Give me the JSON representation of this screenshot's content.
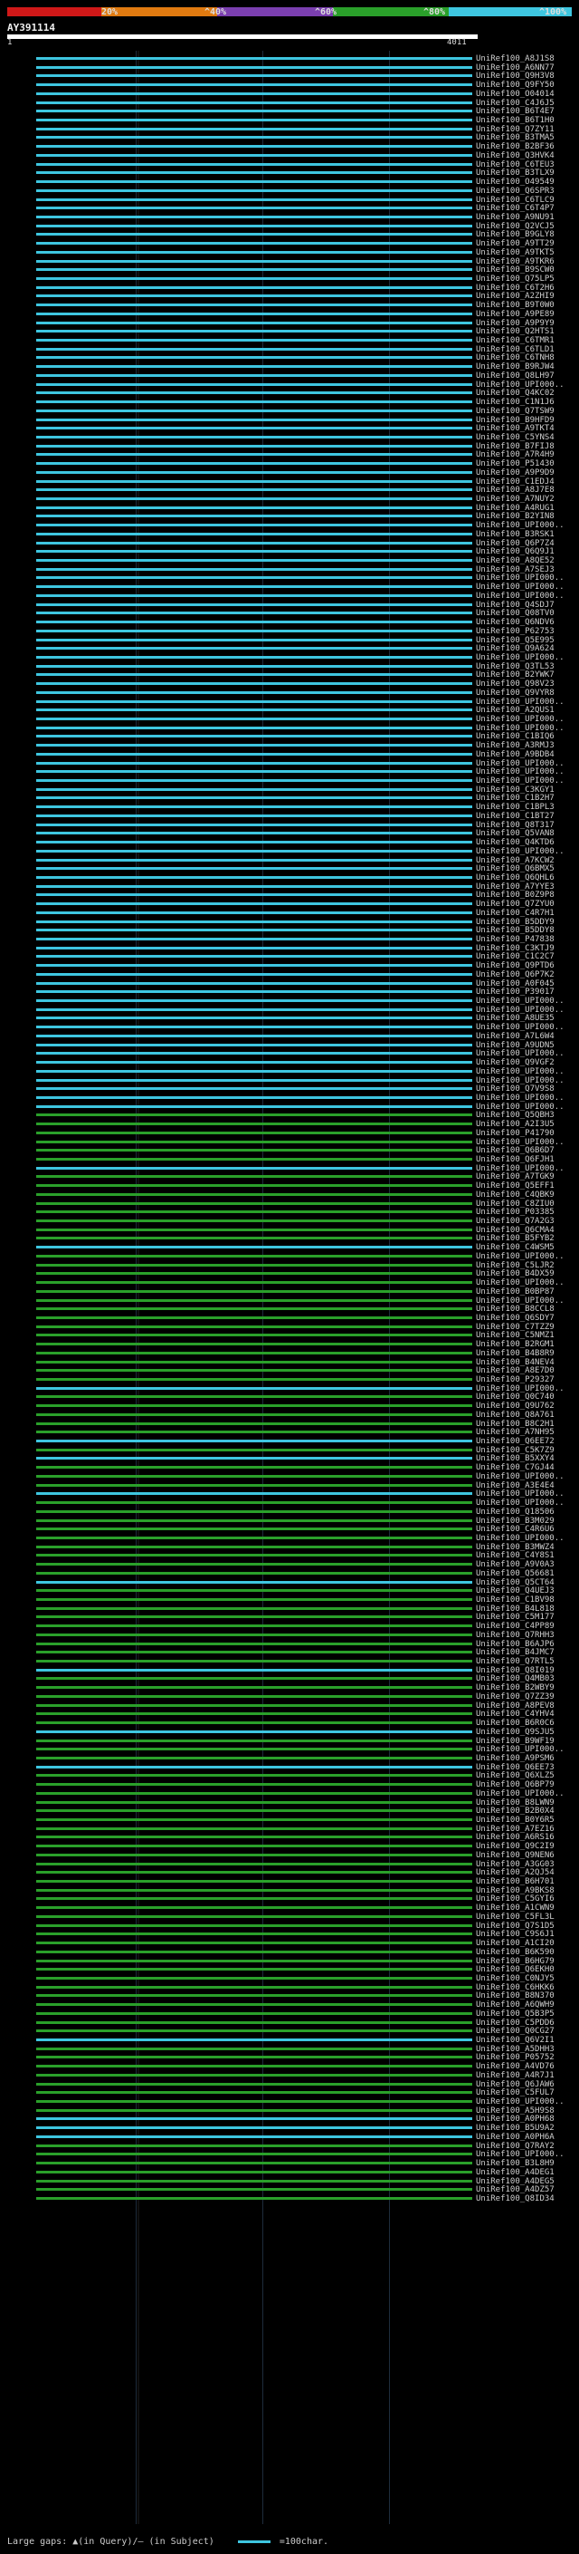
{
  "legend": {
    "ticks": [
      "20%",
      "^40%",
      "^60%",
      "^80%",
      "^100%"
    ],
    "colors": [
      "#d01818",
      "#e07a10",
      "#7b3fb0",
      "#2aa02a",
      "#3ec6e0"
    ]
  },
  "query": {
    "title": "AY391114",
    "start": "1",
    "end": "4011"
  },
  "footer": {
    "gaps_text": "Large gaps: ▲(in Query)/— (in Subject)",
    "scale_text": "=100char."
  },
  "hits": [
    {
      "label": "UniRef100_A8J1S8",
      "color": "#3ec6e0"
    },
    {
      "label": "UniRef100_A6NN77",
      "color": "#3ec6e0"
    },
    {
      "label": "UniRef100_Q9H3V8",
      "color": "#3ec6e0"
    },
    {
      "label": "UniRef100_Q9FY50",
      "color": "#3ec6e0"
    },
    {
      "label": "UniRef100_O04014",
      "color": "#3ec6e0"
    },
    {
      "label": "UniRef100_C4J6J5",
      "color": "#3ec6e0"
    },
    {
      "label": "UniRef100_B6T4E7",
      "color": "#3ec6e0"
    },
    {
      "label": "UniRef100_B6T1H0",
      "color": "#3ec6e0"
    },
    {
      "label": "UniRef100_Q7ZY11",
      "color": "#3ec6e0"
    },
    {
      "label": "UniRef100_B3TMA5",
      "color": "#3ec6e0"
    },
    {
      "label": "UniRef100_B2BF36",
      "color": "#3ec6e0"
    },
    {
      "label": "UniRef100_Q3HVK4",
      "color": "#3ec6e0"
    },
    {
      "label": "UniRef100_C6TEU3",
      "color": "#3ec6e0"
    },
    {
      "label": "UniRef100_B3TLX9",
      "color": "#3ec6e0"
    },
    {
      "label": "UniRef100_O49549",
      "color": "#3ec6e0"
    },
    {
      "label": "UniRef100_Q6SPR3",
      "color": "#3ec6e0"
    },
    {
      "label": "UniRef100_C6TLC9",
      "color": "#3ec6e0"
    },
    {
      "label": "UniRef100_C6T4P7",
      "color": "#3ec6e0"
    },
    {
      "label": "UniRef100_A9NU91",
      "color": "#3ec6e0"
    },
    {
      "label": "UniRef100_Q2VCJ5",
      "color": "#3ec6e0"
    },
    {
      "label": "UniRef100_B9GLY8",
      "color": "#3ec6e0"
    },
    {
      "label": "UniRef100_A9TT29",
      "color": "#3ec6e0"
    },
    {
      "label": "UniRef100_A9TKT5",
      "color": "#3ec6e0"
    },
    {
      "label": "UniRef100_A9TKR6",
      "color": "#3ec6e0"
    },
    {
      "label": "UniRef100_B9SCW0",
      "color": "#3ec6e0"
    },
    {
      "label": "UniRef100_Q75LP5",
      "color": "#3ec6e0"
    },
    {
      "label": "UniRef100_C6T2H6",
      "color": "#3ec6e0"
    },
    {
      "label": "UniRef100_A2ZHI9",
      "color": "#3ec6e0"
    },
    {
      "label": "UniRef100_B9T0W0",
      "color": "#3ec6e0"
    },
    {
      "label": "UniRef100_A9PE89",
      "color": "#3ec6e0"
    },
    {
      "label": "UniRef100_A9P9Y9",
      "color": "#3ec6e0"
    },
    {
      "label": "UniRef100_Q2HTS1",
      "color": "#3ec6e0"
    },
    {
      "label": "UniRef100_C6TMR1",
      "color": "#3ec6e0"
    },
    {
      "label": "UniRef100_C6TLD1",
      "color": "#3ec6e0"
    },
    {
      "label": "UniRef100_C6TNH8",
      "color": "#3ec6e0"
    },
    {
      "label": "UniRef100_B9RJW4",
      "color": "#3ec6e0"
    },
    {
      "label": "UniRef100_Q8LH97",
      "color": "#3ec6e0"
    },
    {
      "label": "UniRef100_UPI000..",
      "color": "#3ec6e0"
    },
    {
      "label": "UniRef100_Q4KC02",
      "color": "#3ec6e0"
    },
    {
      "label": "UniRef100_C1N1J6",
      "color": "#3ec6e0"
    },
    {
      "label": "UniRef100_Q7TSW9",
      "color": "#3ec6e0"
    },
    {
      "label": "UniRef100_B9HFD9",
      "color": "#3ec6e0"
    },
    {
      "label": "UniRef100_A9TKT4",
      "color": "#3ec6e0"
    },
    {
      "label": "UniRef100_C5YNS4",
      "color": "#3ec6e0"
    },
    {
      "label": "UniRef100_B7FIJ8",
      "color": "#3ec6e0"
    },
    {
      "label": "UniRef100_A7R4H9",
      "color": "#3ec6e0"
    },
    {
      "label": "UniRef100_P51430",
      "color": "#3ec6e0"
    },
    {
      "label": "UniRef100_A9P9D9",
      "color": "#3ec6e0"
    },
    {
      "label": "UniRef100_C1EDJ4",
      "color": "#3ec6e0"
    },
    {
      "label": "UniRef100_A8J7E8",
      "color": "#3ec6e0"
    },
    {
      "label": "UniRef100_A7NUY2",
      "color": "#3ec6e0"
    },
    {
      "label": "UniRef100_A4RUG1",
      "color": "#3ec6e0"
    },
    {
      "label": "UniRef100_B2YIN8",
      "color": "#3ec6e0"
    },
    {
      "label": "UniRef100_UPI000..",
      "color": "#3ec6e0"
    },
    {
      "label": "UniRef100_B3RSK1",
      "color": "#3ec6e0"
    },
    {
      "label": "UniRef100_Q6P7Z4",
      "color": "#3ec6e0"
    },
    {
      "label": "UniRef100_Q6Q9J1",
      "color": "#3ec6e0"
    },
    {
      "label": "UniRef100_A8QE52",
      "color": "#3ec6e0"
    },
    {
      "label": "UniRef100_A7SEJ3",
      "color": "#3ec6e0"
    },
    {
      "label": "UniRef100_UPI000..",
      "color": "#3ec6e0"
    },
    {
      "label": "UniRef100_UPI000..",
      "color": "#3ec6e0"
    },
    {
      "label": "UniRef100_UPI000..",
      "color": "#3ec6e0"
    },
    {
      "label": "UniRef100_Q4SDJ7",
      "color": "#3ec6e0"
    },
    {
      "label": "UniRef100_Q08TV0",
      "color": "#3ec6e0"
    },
    {
      "label": "UniRef100_Q6NDV6",
      "color": "#3ec6e0"
    },
    {
      "label": "UniRef100_P62753",
      "color": "#3ec6e0"
    },
    {
      "label": "UniRef100_Q5E995",
      "color": "#3ec6e0"
    },
    {
      "label": "UniRef100_Q9A624",
      "color": "#3ec6e0"
    },
    {
      "label": "UniRef100_UPI000..",
      "color": "#3ec6e0"
    },
    {
      "label": "UniRef100_Q3TL53",
      "color": "#3ec6e0"
    },
    {
      "label": "UniRef100_B2YWK7",
      "color": "#3ec6e0"
    },
    {
      "label": "UniRef100_Q98V23",
      "color": "#3ec6e0"
    },
    {
      "label": "UniRef100_Q9VYR8",
      "color": "#3ec6e0"
    },
    {
      "label": "UniRef100_UPI000..",
      "color": "#3ec6e0"
    },
    {
      "label": "UniRef100_A2QUS1",
      "color": "#3ec6e0"
    },
    {
      "label": "UniRef100_UPI000..",
      "color": "#3ec6e0"
    },
    {
      "label": "UniRef100_UPI000..",
      "color": "#3ec6e0"
    },
    {
      "label": "UniRef100_C1BIQ6",
      "color": "#3ec6e0"
    },
    {
      "label": "UniRef100_A3RMJ3",
      "color": "#3ec6e0"
    },
    {
      "label": "UniRef100_A9BDB4",
      "color": "#3ec6e0"
    },
    {
      "label": "UniRef100_UPI000..",
      "color": "#3ec6e0"
    },
    {
      "label": "UniRef100_UPI000..",
      "color": "#3ec6e0"
    },
    {
      "label": "UniRef100_UPI000..",
      "color": "#3ec6e0"
    },
    {
      "label": "UniRef100_C3KGY1",
      "color": "#3ec6e0"
    },
    {
      "label": "UniRef100_C1B2H7",
      "color": "#3ec6e0"
    },
    {
      "label": "UniRef100_C1BPL3",
      "color": "#3ec6e0"
    },
    {
      "label": "UniRef100_C1BT27",
      "color": "#3ec6e0"
    },
    {
      "label": "UniRef100_Q8T317",
      "color": "#3ec6e0"
    },
    {
      "label": "UniRef100_Q5VAN8",
      "color": "#3ec6e0"
    },
    {
      "label": "UniRef100_Q4KTD6",
      "color": "#3ec6e0"
    },
    {
      "label": "UniRef100_UPI000..",
      "color": "#3ec6e0"
    },
    {
      "label": "UniRef100_A7KCW2",
      "color": "#3ec6e0"
    },
    {
      "label": "UniRef100_Q6BMX5",
      "color": "#3ec6e0"
    },
    {
      "label": "UniRef100_Q6QHL6",
      "color": "#3ec6e0"
    },
    {
      "label": "UniRef100_A7YYE3",
      "color": "#3ec6e0"
    },
    {
      "label": "UniRef100_B0Z9P8",
      "color": "#3ec6e0"
    },
    {
      "label": "UniRef100_Q7ZYU0",
      "color": "#3ec6e0"
    },
    {
      "label": "UniRef100_C4R7H1",
      "color": "#3ec6e0"
    },
    {
      "label": "UniRef100_B5DDY9",
      "color": "#3ec6e0"
    },
    {
      "label": "UniRef100_B5DDY8",
      "color": "#3ec6e0"
    },
    {
      "label": "UniRef100_P47838",
      "color": "#3ec6e0"
    },
    {
      "label": "UniRef100_C3KTJ9",
      "color": "#3ec6e0"
    },
    {
      "label": "UniRef100_C1C2C7",
      "color": "#3ec6e0"
    },
    {
      "label": "UniRef100_Q9PTD6",
      "color": "#3ec6e0"
    },
    {
      "label": "UniRef100_Q6P7K2",
      "color": "#3ec6e0"
    },
    {
      "label": "UniRef100_A0F045",
      "color": "#3ec6e0"
    },
    {
      "label": "UniRef100_P39017",
      "color": "#3ec6e0"
    },
    {
      "label": "UniRef100_UPI000..",
      "color": "#3ec6e0"
    },
    {
      "label": "UniRef100_UPI000..",
      "color": "#3ec6e0"
    },
    {
      "label": "UniRef100_A8UE35",
      "color": "#3ec6e0"
    },
    {
      "label": "UniRef100_UPI000..",
      "color": "#3ec6e0"
    },
    {
      "label": "UniRef100_A7L6W4",
      "color": "#3ec6e0"
    },
    {
      "label": "UniRef100_A9UDN5",
      "color": "#3ec6e0"
    },
    {
      "label": "UniRef100_UPI000..",
      "color": "#3ec6e0"
    },
    {
      "label": "UniRef100_Q9VGF2",
      "color": "#3ec6e0"
    },
    {
      "label": "UniRef100_UPI000..",
      "color": "#3ec6e0"
    },
    {
      "label": "UniRef100_UPI000..",
      "color": "#3ec6e0"
    },
    {
      "label": "UniRef100_Q7V9S8",
      "color": "#3ec6e0"
    },
    {
      "label": "UniRef100_UPI000..",
      "color": "#3ec6e0"
    },
    {
      "label": "UniRef100_UPI000..",
      "color": "#3ec6e0"
    },
    {
      "label": "UniRef100_Q5QBH3",
      "color": "#2aa02a"
    },
    {
      "label": "UniRef100_A2I3U5",
      "color": "#2aa02a"
    },
    {
      "label": "UniRef100_P41790",
      "color": "#2aa02a"
    },
    {
      "label": "UniRef100_UPI000..",
      "color": "#2aa02a"
    },
    {
      "label": "UniRef100_Q6B6D7",
      "color": "#2aa02a"
    },
    {
      "label": "UniRef100_Q6FJH1",
      "color": "#2aa02a"
    },
    {
      "label": "UniRef100_UPI000..",
      "color": "#3ec6e0"
    },
    {
      "label": "UniRef100_A7TGK9",
      "color": "#2aa02a"
    },
    {
      "label": "UniRef100_Q5EFF1",
      "color": "#2aa02a"
    },
    {
      "label": "UniRef100_C4QBK9",
      "color": "#2aa02a"
    },
    {
      "label": "UniRef100_C8ZIU0",
      "color": "#2aa02a"
    },
    {
      "label": "UniRef100_P03385",
      "color": "#2aa02a"
    },
    {
      "label": "UniRef100_Q7A2G3",
      "color": "#2aa02a"
    },
    {
      "label": "UniRef100_Q6CMA4",
      "color": "#2aa02a"
    },
    {
      "label": "UniRef100_B5FYB2",
      "color": "#2aa02a"
    },
    {
      "label": "UniRef100_C4WSM5",
      "color": "#3ec6e0"
    },
    {
      "label": "UniRef100_UPI000..",
      "color": "#2aa02a"
    },
    {
      "label": "UniRef100_C5LJR2",
      "color": "#2aa02a"
    },
    {
      "label": "UniRef100_B4DX59",
      "color": "#2aa02a"
    },
    {
      "label": "UniRef100_UPI000..",
      "color": "#2aa02a"
    },
    {
      "label": "UniRef100_B0BP87",
      "color": "#2aa02a"
    },
    {
      "label": "UniRef100_UPI000..",
      "color": "#2aa02a"
    },
    {
      "label": "UniRef100_B8CCL8",
      "color": "#2aa02a"
    },
    {
      "label": "UniRef100_Q6SDY7",
      "color": "#2aa02a"
    },
    {
      "label": "UniRef100_C7TZZ9",
      "color": "#2aa02a"
    },
    {
      "label": "UniRef100_C5NMZ1",
      "color": "#2aa02a"
    },
    {
      "label": "UniRef100_B2RGM1",
      "color": "#2aa02a"
    },
    {
      "label": "UniRef100_B4B8R9",
      "color": "#2aa02a"
    },
    {
      "label": "UniRef100_B4NEV4",
      "color": "#2aa02a"
    },
    {
      "label": "UniRef100_A8E7D0",
      "color": "#2aa02a"
    },
    {
      "label": "UniRef100_P29327",
      "color": "#2aa02a"
    },
    {
      "label": "UniRef100_UPI000..",
      "color": "#3ec6e0"
    },
    {
      "label": "UniRef100_Q0C740",
      "color": "#2aa02a"
    },
    {
      "label": "UniRef100_Q9U762",
      "color": "#2aa02a"
    },
    {
      "label": "UniRef100_Q8A761",
      "color": "#2aa02a"
    },
    {
      "label": "UniRef100_B8C2H1",
      "color": "#2aa02a"
    },
    {
      "label": "UniRef100_A7NH95",
      "color": "#2aa02a"
    },
    {
      "label": "UniRef100_Q6EE72",
      "color": "#3ec6e0"
    },
    {
      "label": "UniRef100_C5K7Z9",
      "color": "#2aa02a"
    },
    {
      "label": "UniRef100_B5XXY4",
      "color": "#3ec6e0"
    },
    {
      "label": "UniRef100_C7GJ44",
      "color": "#2aa02a"
    },
    {
      "label": "UniRef100_UPI000..",
      "color": "#2aa02a"
    },
    {
      "label": "UniRef100_A3E4E4",
      "color": "#2aa02a"
    },
    {
      "label": "UniRef100_UPI000..",
      "color": "#3ec6e0"
    },
    {
      "label": "UniRef100_UPI000..",
      "color": "#2aa02a"
    },
    {
      "label": "UniRef100_Q18506",
      "color": "#2aa02a"
    },
    {
      "label": "UniRef100_B3M029",
      "color": "#2aa02a"
    },
    {
      "label": "UniRef100_C4R6U6",
      "color": "#2aa02a"
    },
    {
      "label": "UniRef100_UPI000..",
      "color": "#2aa02a"
    },
    {
      "label": "UniRef100_B3MWZ4",
      "color": "#2aa02a"
    },
    {
      "label": "UniRef100_C4Y8S1",
      "color": "#2aa02a"
    },
    {
      "label": "UniRef100_A9V0A3",
      "color": "#2aa02a"
    },
    {
      "label": "UniRef100_Q56681",
      "color": "#2aa02a"
    },
    {
      "label": "UniRef100_Q5CT64",
      "color": "#3ec6e0"
    },
    {
      "label": "UniRef100_Q4UEJ3",
      "color": "#2aa02a"
    },
    {
      "label": "UniRef100_C1BV98",
      "color": "#2aa02a"
    },
    {
      "label": "UniRef100_B4L818",
      "color": "#2aa02a"
    },
    {
      "label": "UniRef100_C5M177",
      "color": "#2aa02a"
    },
    {
      "label": "UniRef100_C4PP89",
      "color": "#2aa02a"
    },
    {
      "label": "UniRef100_Q7RHH3",
      "color": "#2aa02a"
    },
    {
      "label": "UniRef100_B6AJP6",
      "color": "#2aa02a"
    },
    {
      "label": "UniRef100_B4JMC7",
      "color": "#2aa02a"
    },
    {
      "label": "UniRef100_Q7RTL5",
      "color": "#2aa02a"
    },
    {
      "label": "UniRef100_Q8I019",
      "color": "#3ec6e0"
    },
    {
      "label": "UniRef100_Q4MB03",
      "color": "#2aa02a"
    },
    {
      "label": "UniRef100_B2WBY9",
      "color": "#2aa02a"
    },
    {
      "label": "UniRef100_Q7ZZ39",
      "color": "#2aa02a"
    },
    {
      "label": "UniRef100_A8PEV8",
      "color": "#2aa02a"
    },
    {
      "label": "UniRef100_C4YHV4",
      "color": "#2aa02a"
    },
    {
      "label": "UniRef100_B6R0C6",
      "color": "#2aa02a"
    },
    {
      "label": "UniRef100_Q9SJU5",
      "color": "#3ec6e0"
    },
    {
      "label": "UniRef100_B9WF19",
      "color": "#2aa02a"
    },
    {
      "label": "UniRef100_UPI000..",
      "color": "#2aa02a"
    },
    {
      "label": "UniRef100_A9PSM6",
      "color": "#2aa02a"
    },
    {
      "label": "UniRef100_Q6EE73",
      "color": "#3ec6e0"
    },
    {
      "label": "UniRef100_Q6XLZ5",
      "color": "#2aa02a"
    },
    {
      "label": "UniRef100_Q6BP79",
      "color": "#2aa02a"
    },
    {
      "label": "UniRef100_UPI000..",
      "color": "#2aa02a"
    },
    {
      "label": "UniRef100_B8LWN9",
      "color": "#2aa02a"
    },
    {
      "label": "UniRef100_B2B0X4",
      "color": "#2aa02a"
    },
    {
      "label": "UniRef100_B0Y6R5",
      "color": "#2aa02a"
    },
    {
      "label": "UniRef100_A7EZ16",
      "color": "#2aa02a"
    },
    {
      "label": "UniRef100_A6RS16",
      "color": "#2aa02a"
    },
    {
      "label": "UniRef100_Q9C2I9",
      "color": "#2aa02a"
    },
    {
      "label": "UniRef100_Q9NEN6",
      "color": "#2aa02a"
    },
    {
      "label": "UniRef100_A3GG03",
      "color": "#2aa02a"
    },
    {
      "label": "UniRef100_A2QJ54",
      "color": "#2aa02a"
    },
    {
      "label": "UniRef100_B6H701",
      "color": "#2aa02a"
    },
    {
      "label": "UniRef100_A9BKS8",
      "color": "#2aa02a"
    },
    {
      "label": "UniRef100_C5GYI6",
      "color": "#2aa02a"
    },
    {
      "label": "UniRef100_A1CWN9",
      "color": "#2aa02a"
    },
    {
      "label": "UniRef100_C5FL3L",
      "color": "#2aa02a"
    },
    {
      "label": "UniRef100_Q7S1D5",
      "color": "#2aa02a"
    },
    {
      "label": "UniRef100_C9S6J1",
      "color": "#2aa02a"
    },
    {
      "label": "UniRef100_A1CI20",
      "color": "#2aa02a"
    },
    {
      "label": "UniRef100_B6K590",
      "color": "#2aa02a"
    },
    {
      "label": "UniRef100_B6HG79",
      "color": "#2aa02a"
    },
    {
      "label": "UniRef100_Q6EKH0",
      "color": "#2aa02a"
    },
    {
      "label": "UniRef100_C0NJY5",
      "color": "#2aa02a"
    },
    {
      "label": "UniRef100_C6HKK6",
      "color": "#2aa02a"
    },
    {
      "label": "UniRef100_B8N370",
      "color": "#2aa02a"
    },
    {
      "label": "UniRef100_A6QWH9",
      "color": "#2aa02a"
    },
    {
      "label": "UniRef100_Q5B3P5",
      "color": "#2aa02a"
    },
    {
      "label": "UniRef100_C5PDD6",
      "color": "#2aa02a"
    },
    {
      "label": "UniRef100_Q0CG27",
      "color": "#2aa02a"
    },
    {
      "label": "UniRef100_Q6V2I1",
      "color": "#3ec6e0"
    },
    {
      "label": "UniRef100_A5DHH3",
      "color": "#2aa02a"
    },
    {
      "label": "UniRef100_P05752",
      "color": "#2aa02a"
    },
    {
      "label": "UniRef100_A4VD76",
      "color": "#2aa02a"
    },
    {
      "label": "UniRef100_A4R7J1",
      "color": "#2aa02a"
    },
    {
      "label": "UniRef100_Q6JAW6",
      "color": "#2aa02a"
    },
    {
      "label": "UniRef100_C5FUL7",
      "color": "#2aa02a"
    },
    {
      "label": "UniRef100_UPI000..",
      "color": "#2aa02a"
    },
    {
      "label": "UniRef100_A5H9S8",
      "color": "#2aa02a"
    },
    {
      "label": "UniRef100_A0PH68",
      "color": "#3ec6e0"
    },
    {
      "label": "UniRef100_B5U9A2",
      "color": "#3ec6e0"
    },
    {
      "label": "UniRef100_A0PH6A",
      "color": "#3ec6e0"
    },
    {
      "label": "UniRef100_Q7RAY2",
      "color": "#2aa02a"
    },
    {
      "label": "UniRef100_UPI000..",
      "color": "#2aa02a"
    },
    {
      "label": "UniRef100_B3L8H9",
      "color": "#2aa02a"
    },
    {
      "label": "UniRef100_A4DEG1",
      "color": "#2aa02a"
    },
    {
      "label": "UniRef100_A4DEG5",
      "color": "#2aa02a"
    },
    {
      "label": "UniRef100_A4DZ57",
      "color": "#2aa02a"
    },
    {
      "label": "UniRef100_Q8ID34",
      "color": "#2aa02a"
    }
  ]
}
